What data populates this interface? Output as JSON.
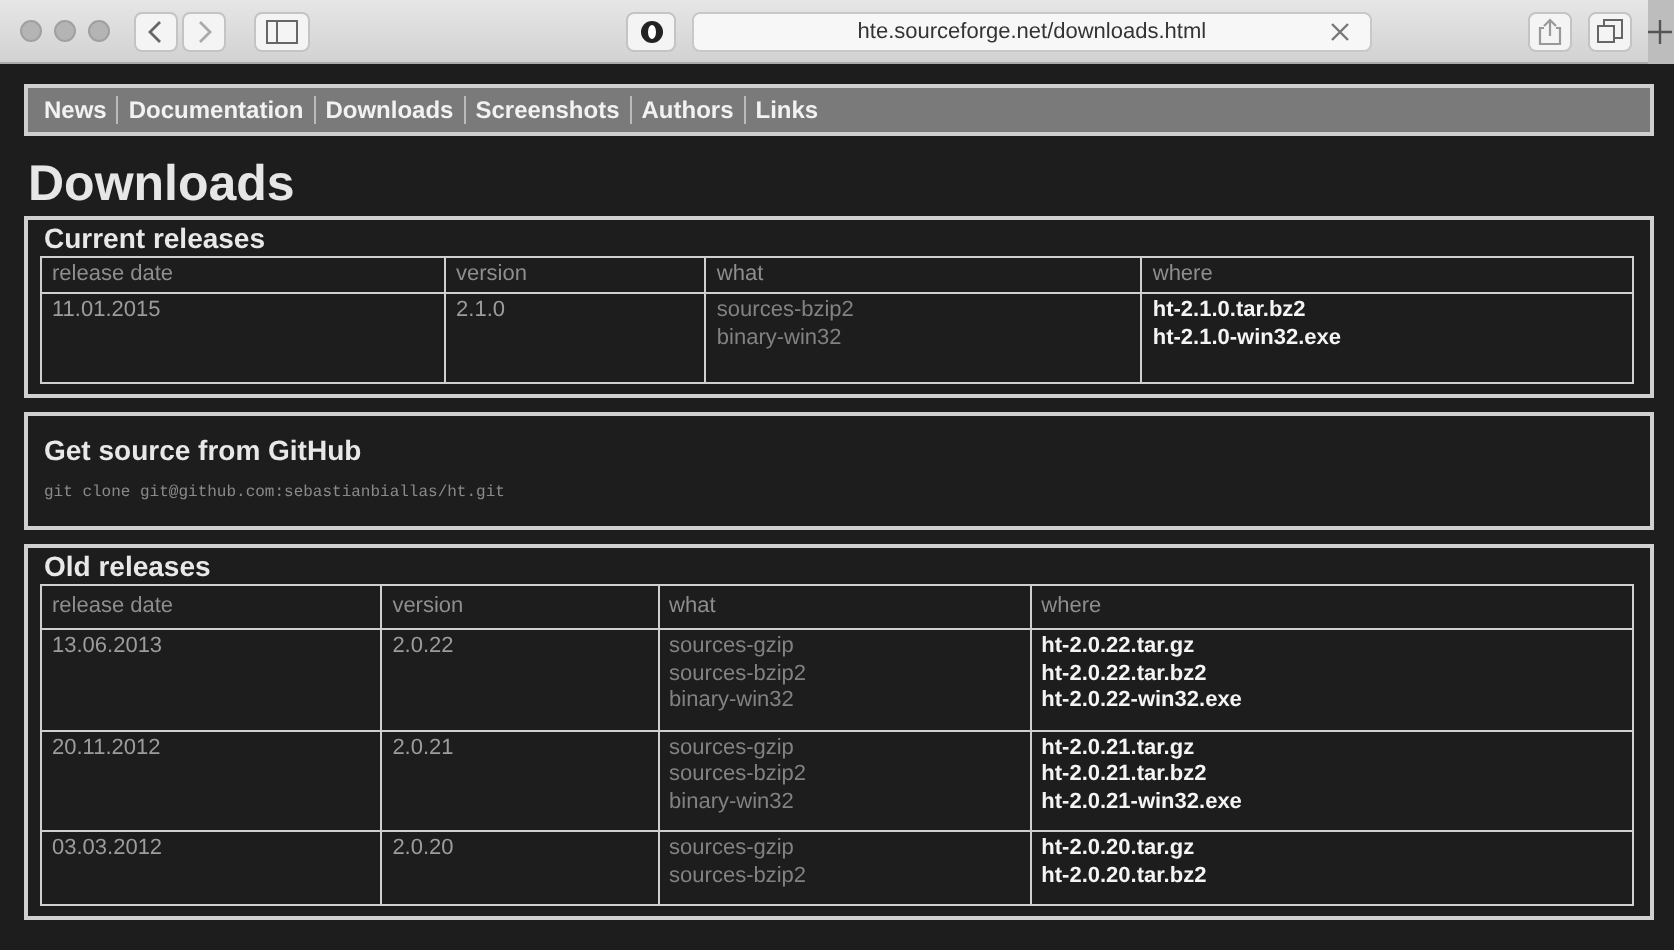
{
  "browser": {
    "url": "hte.sourceforge.net/downloads.html"
  },
  "nav": [
    {
      "label": "News"
    },
    {
      "label": "Documentation"
    },
    {
      "label": "Downloads"
    },
    {
      "label": "Screenshots"
    },
    {
      "label": "Authors"
    },
    {
      "label": "Links"
    }
  ],
  "title": "Downloads",
  "sections": [
    {
      "kind": "table",
      "heading": "Current releases",
      "columns": [
        "release date",
        "version",
        "what",
        "where"
      ],
      "rows": [
        {
          "date": "11.01.2015",
          "version": "2.1.0",
          "what": [
            "sources-bzip2",
            "binary-win32"
          ],
          "where": [
            "ht-2.1.0.tar.bz2",
            "ht-2.1.0-win32.exe"
          ]
        }
      ]
    },
    {
      "kind": "code",
      "heading": "Get source from GitHub",
      "code": "git clone git@github.com:sebastianbiallas/ht.git"
    },
    {
      "kind": "table",
      "heading": "Old releases",
      "columns": [
        "release date",
        "version",
        "what",
        "where"
      ],
      "rows": [
        {
          "date": "13.06.2013",
          "version": "2.0.22",
          "what": [
            "sources-gzip",
            "sources-bzip2",
            "binary-win32"
          ],
          "where": [
            "ht-2.0.22.tar.gz",
            "ht-2.0.22.tar.bz2",
            "ht-2.0.22-win32.exe"
          ]
        },
        {
          "date": "20.11.2012",
          "version": "2.0.21",
          "what": [
            "sources-gzip",
            "sources-bzip2",
            "binary-win32"
          ],
          "where": [
            "ht-2.0.21.tar.gz",
            "ht-2.0.21.tar.bz2",
            "ht-2.0.21-win32.exe"
          ]
        },
        {
          "date": "03.03.2012",
          "version": "2.0.20",
          "what": [
            "sources-gzip",
            "sources-bzip2"
          ],
          "where": [
            "ht-2.0.20.tar.gz",
            "ht-2.0.20.tar.bz2"
          ]
        }
      ]
    }
  ]
}
